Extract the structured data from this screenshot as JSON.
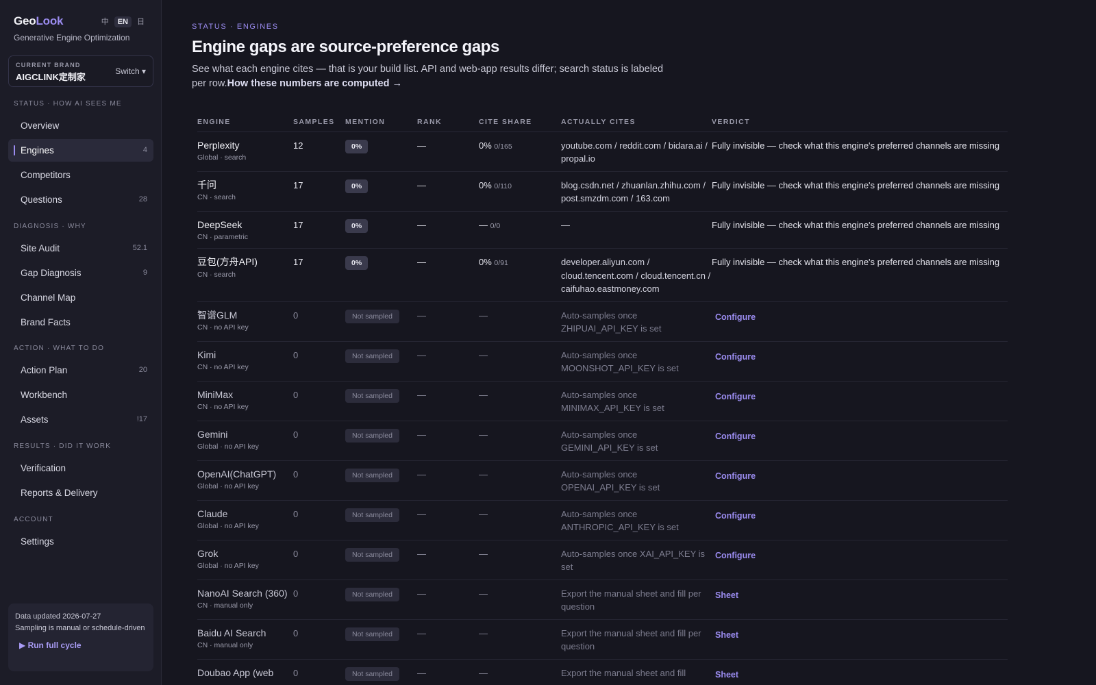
{
  "app": {
    "logo_a": "Geo",
    "logo_b": "Look",
    "tagline": "Generative Engine Optimization",
    "lang": [
      "中",
      "EN",
      "日"
    ]
  },
  "brand": {
    "label": "CURRENT BRAND",
    "name": "AIGCLINK定制家",
    "switch": "Switch ▾"
  },
  "nav": {
    "sections": [
      "STATUS · HOW AI SEES ME",
      "DIAGNOSIS · WHY",
      "ACTION · WHAT TO DO",
      "RESULTS · DID IT WORK",
      "ACCOUNT"
    ],
    "items": [
      {
        "label": "Overview",
        "count": ""
      },
      {
        "label": "Engines",
        "count": "4"
      },
      {
        "label": "Competitors",
        "count": ""
      },
      {
        "label": "Questions",
        "count": "28"
      },
      {
        "label": "Site Audit",
        "count": "52.1"
      },
      {
        "label": "Gap Diagnosis",
        "count": "9"
      },
      {
        "label": "Channel Map",
        "count": ""
      },
      {
        "label": "Brand Facts",
        "count": ""
      },
      {
        "label": "Action Plan",
        "count": "20"
      },
      {
        "label": "Workbench",
        "count": ""
      },
      {
        "label": "Assets",
        "count": "!17"
      },
      {
        "label": "Verification",
        "count": ""
      },
      {
        "label": "Reports & Delivery",
        "count": ""
      },
      {
        "label": "Settings",
        "count": ""
      }
    ]
  },
  "footer": {
    "line1": "Data updated 2026-07-27",
    "line2": "Sampling is manual or schedule-driven",
    "run": "▶ Run full cycle"
  },
  "page": {
    "eyebrow": "STATUS · ENGINES",
    "title": "Engine gaps are source-preference gaps",
    "desc": "See what each engine cites — that is your build list. API and web-app results differ; search status is labeled per row.",
    "desc_link": "How these numbers are computed →"
  },
  "table": {
    "headers": [
      "ENGINE",
      "SAMPLES",
      "MENTION",
      "RANK",
      "CITE SHARE",
      "ACTUALLY CITES",
      "VERDICT"
    ],
    "rows": [
      {
        "name": "Perplexity",
        "sub": "Global · search",
        "samples": "12",
        "mention": "0%",
        "rank": "—",
        "share": "0%",
        "share_sub": "0/165",
        "cites": "youtube.com / reddit.com / bidara.ai / propal.io",
        "verdict": "Fully invisible — check what this engine's preferred channels are missing",
        "muted": false
      },
      {
        "name": "千问",
        "sub": "CN · search",
        "samples": "17",
        "mention": "0%",
        "rank": "—",
        "share": "0%",
        "share_sub": "0/110",
        "cites": "blog.csdn.net / zhuanlan.zhihu.com / post.smzdm.com / 163.com",
        "verdict": "Fully invisible — check what this engine's preferred channels are missing",
        "muted": false
      },
      {
        "name": "DeepSeek",
        "sub": "CN · parametric",
        "samples": "17",
        "mention": "0%",
        "rank": "—",
        "share": "—",
        "share_sub": "0/0",
        "cites": "—",
        "verdict": "Fully invisible — check what this engine's preferred channels are missing",
        "muted": false
      },
      {
        "name": "豆包(方舟API)",
        "sub": "CN · search",
        "samples": "17",
        "mention": "0%",
        "rank": "—",
        "share": "0%",
        "share_sub": "0/91",
        "cites": "developer.aliyun.com / cloud.tencent.com / cloud.tencent.cn / caifuhao.eastmoney.com",
        "verdict": "Fully invisible — check what this engine's preferred channels are missing",
        "muted": false
      },
      {
        "name": "智谱GLM",
        "sub": "CN · no API key",
        "samples": "0",
        "mention": "Not sampled",
        "rank": "—",
        "share": "—",
        "share_sub": "",
        "cites": "Auto-samples once ZHIPUAI_API_KEY is set",
        "verdict": "Configure",
        "muted": true
      },
      {
        "name": "Kimi",
        "sub": "CN · no API key",
        "samples": "0",
        "mention": "Not sampled",
        "rank": "—",
        "share": "—",
        "share_sub": "",
        "cites": "Auto-samples once MOONSHOT_API_KEY is set",
        "verdict": "Configure",
        "muted": true
      },
      {
        "name": "MiniMax",
        "sub": "CN · no API key",
        "samples": "0",
        "mention": "Not sampled",
        "rank": "—",
        "share": "—",
        "share_sub": "",
        "cites": "Auto-samples once MINIMAX_API_KEY is set",
        "verdict": "Configure",
        "muted": true
      },
      {
        "name": "Gemini",
        "sub": "Global · no API key",
        "samples": "0",
        "mention": "Not sampled",
        "rank": "—",
        "share": "—",
        "share_sub": "",
        "cites": "Auto-samples once GEMINI_API_KEY is set",
        "verdict": "Configure",
        "muted": true
      },
      {
        "name": "OpenAI(ChatGPT)",
        "sub": "Global · no API key",
        "samples": "0",
        "mention": "Not sampled",
        "rank": "—",
        "share": "—",
        "share_sub": "",
        "cites": "Auto-samples once OPENAI_API_KEY is set",
        "verdict": "Configure",
        "muted": true
      },
      {
        "name": "Claude",
        "sub": "Global · no API key",
        "samples": "0",
        "mention": "Not sampled",
        "rank": "—",
        "share": "—",
        "share_sub": "",
        "cites": "Auto-samples once ANTHROPIC_API_KEY is set",
        "verdict": "Configure",
        "muted": true
      },
      {
        "name": "Grok",
        "sub": "Global · no API key",
        "samples": "0",
        "mention": "Not sampled",
        "rank": "—",
        "share": "—",
        "share_sub": "",
        "cites": "Auto-samples once XAI_API_KEY is set",
        "verdict": "Configure",
        "muted": true
      },
      {
        "name": "NanoAI Search (360)",
        "sub": "CN · manual only",
        "samples": "0",
        "mention": "Not sampled",
        "rank": "—",
        "share": "—",
        "share_sub": "",
        "cites": "Export the manual sheet and fill per question",
        "verdict": "Sheet",
        "muted": true
      },
      {
        "name": "Baidu AI Search",
        "sub": "CN · manual only",
        "samples": "0",
        "mention": "Not sampled",
        "rank": "—",
        "share": "—",
        "share_sub": "",
        "cites": "Export the manual sheet and fill per question",
        "verdict": "Sheet",
        "muted": true
      },
      {
        "name": "Doubao App (web",
        "sub": "",
        "samples": "0",
        "mention": "Not sampled",
        "rank": "—",
        "share": "—",
        "share_sub": "",
        "cites": "Export the manual sheet and fill",
        "verdict": "Sheet",
        "muted": true
      }
    ]
  }
}
